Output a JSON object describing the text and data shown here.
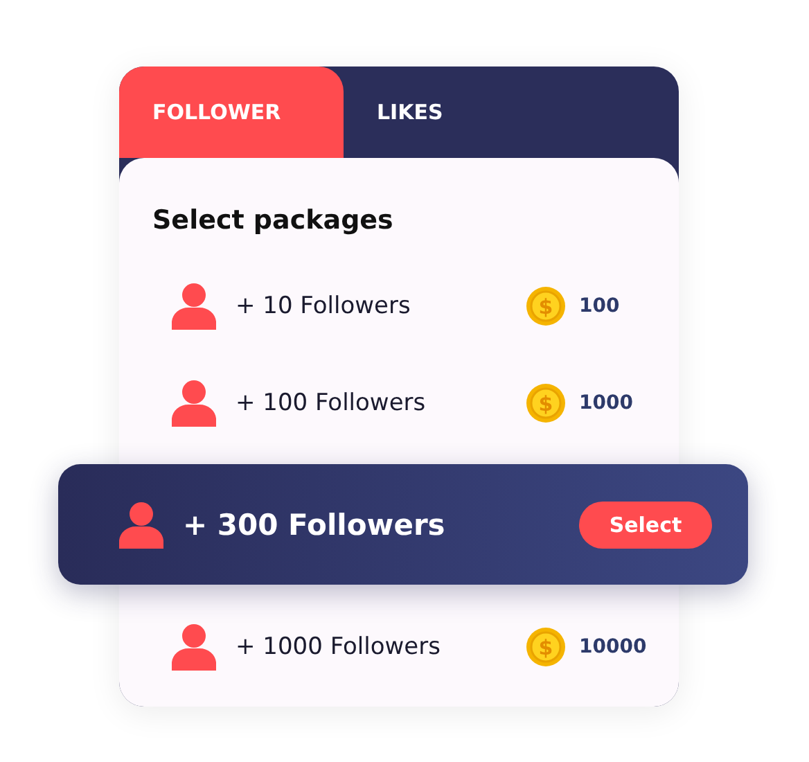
{
  "tabs": [
    {
      "label": "FOLLOWER",
      "selected": true
    },
    {
      "label": "LIKES",
      "selected": false
    }
  ],
  "title": "Select packages",
  "packages": [
    {
      "label": "+ 10 Followers",
      "coin_symbol": "$",
      "price": "100",
      "selected": false
    },
    {
      "label": "+ 100 Followers",
      "coin_symbol": "$",
      "price": "1000",
      "selected": false
    },
    {
      "label": "+ 300 Followers",
      "button": "Select",
      "selected": true
    },
    {
      "label": "+ 1000 Followers",
      "coin_symbol": "$",
      "price": "10000",
      "selected": false
    }
  ]
}
